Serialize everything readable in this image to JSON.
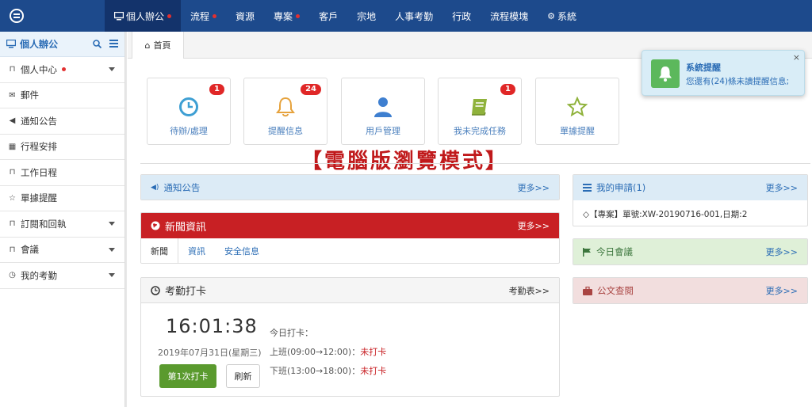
{
  "topnav": {
    "items": [
      {
        "label": "個人辦公",
        "icon": "monitor-icon",
        "active": true,
        "dot": true
      },
      {
        "label": "流程",
        "dot": true
      },
      {
        "label": "資源"
      },
      {
        "label": "專案",
        "dot": true
      },
      {
        "label": "客戶"
      },
      {
        "label": "宗地"
      },
      {
        "label": "人事考勤"
      },
      {
        "label": "行政"
      },
      {
        "label": "流程模塊"
      },
      {
        "label": "系統",
        "icon": "gear-icon"
      }
    ]
  },
  "sidebar": {
    "title": "個人辦公",
    "items": [
      {
        "label": "個人中心",
        "icon": "bookmark-icon",
        "dot": true,
        "caret": true
      },
      {
        "label": "郵件",
        "icon": "envelope-icon"
      },
      {
        "label": "通知公告",
        "icon": "volume-icon"
      },
      {
        "label": "行程安排",
        "icon": "calendar-icon"
      },
      {
        "label": "工作日程",
        "icon": "bookmark-icon"
      },
      {
        "label": "單據提醒",
        "icon": "star-icon"
      },
      {
        "label": "訂閱和回執",
        "icon": "bookmark-icon",
        "caret": true
      },
      {
        "label": "會議",
        "icon": "bookmark-icon",
        "caret": true
      },
      {
        "label": "我的考勤",
        "icon": "clock-icon",
        "caret": true
      }
    ]
  },
  "tabbar": {
    "home_label": "首頁"
  },
  "tiles": [
    {
      "label": "待辦/處理",
      "badge": "1",
      "icon": "clock-icon"
    },
    {
      "label": "提醒信息",
      "badge": "24",
      "icon": "bell-icon"
    },
    {
      "label": "用戶管理",
      "badge": "",
      "icon": "user-icon"
    },
    {
      "label": "我未完成任務",
      "badge": "1",
      "icon": "book-icon"
    },
    {
      "label": "單據提醒",
      "badge": "",
      "icon": "star-icon"
    }
  ],
  "banner": "【電腦版瀏覽模式】",
  "notice": {
    "title": "通知公告",
    "more": "更多>>"
  },
  "news": {
    "title": "新聞資訊",
    "more": "更多>>",
    "tabs": [
      "新聞",
      "資訊",
      "安全信息"
    ]
  },
  "attendance": {
    "title": "考勤打卡",
    "link": "考勤表>>",
    "time": "16:01:38",
    "date": "2019年07月31日(星期三)",
    "today_label": "今日打卡：",
    "morning": "上班(09:00→12:00)：",
    "afternoon": "下班(13:00→18:00)：",
    "not_punched": "未打卡",
    "punch_button": "第1次打卡",
    "refresh_button": "刷新"
  },
  "my_apply": {
    "title": "我的申請(1)",
    "more": "更多>>",
    "item": "◇【專案】單號:XW-20190716-001,日期:2"
  },
  "meeting": {
    "title": "今日會議",
    "more": "更多>>"
  },
  "document": {
    "title": "公文查閱",
    "more": "更多>>"
  },
  "toast": {
    "title": "系統提醒",
    "message": "您還有(24)條未讀提醒信息;",
    "close": "×"
  },
  "colors": {
    "nav": "#1d4a8c",
    "accent": "#2a6cb5",
    "danger": "#c82024",
    "success": "#5a9a2e"
  }
}
